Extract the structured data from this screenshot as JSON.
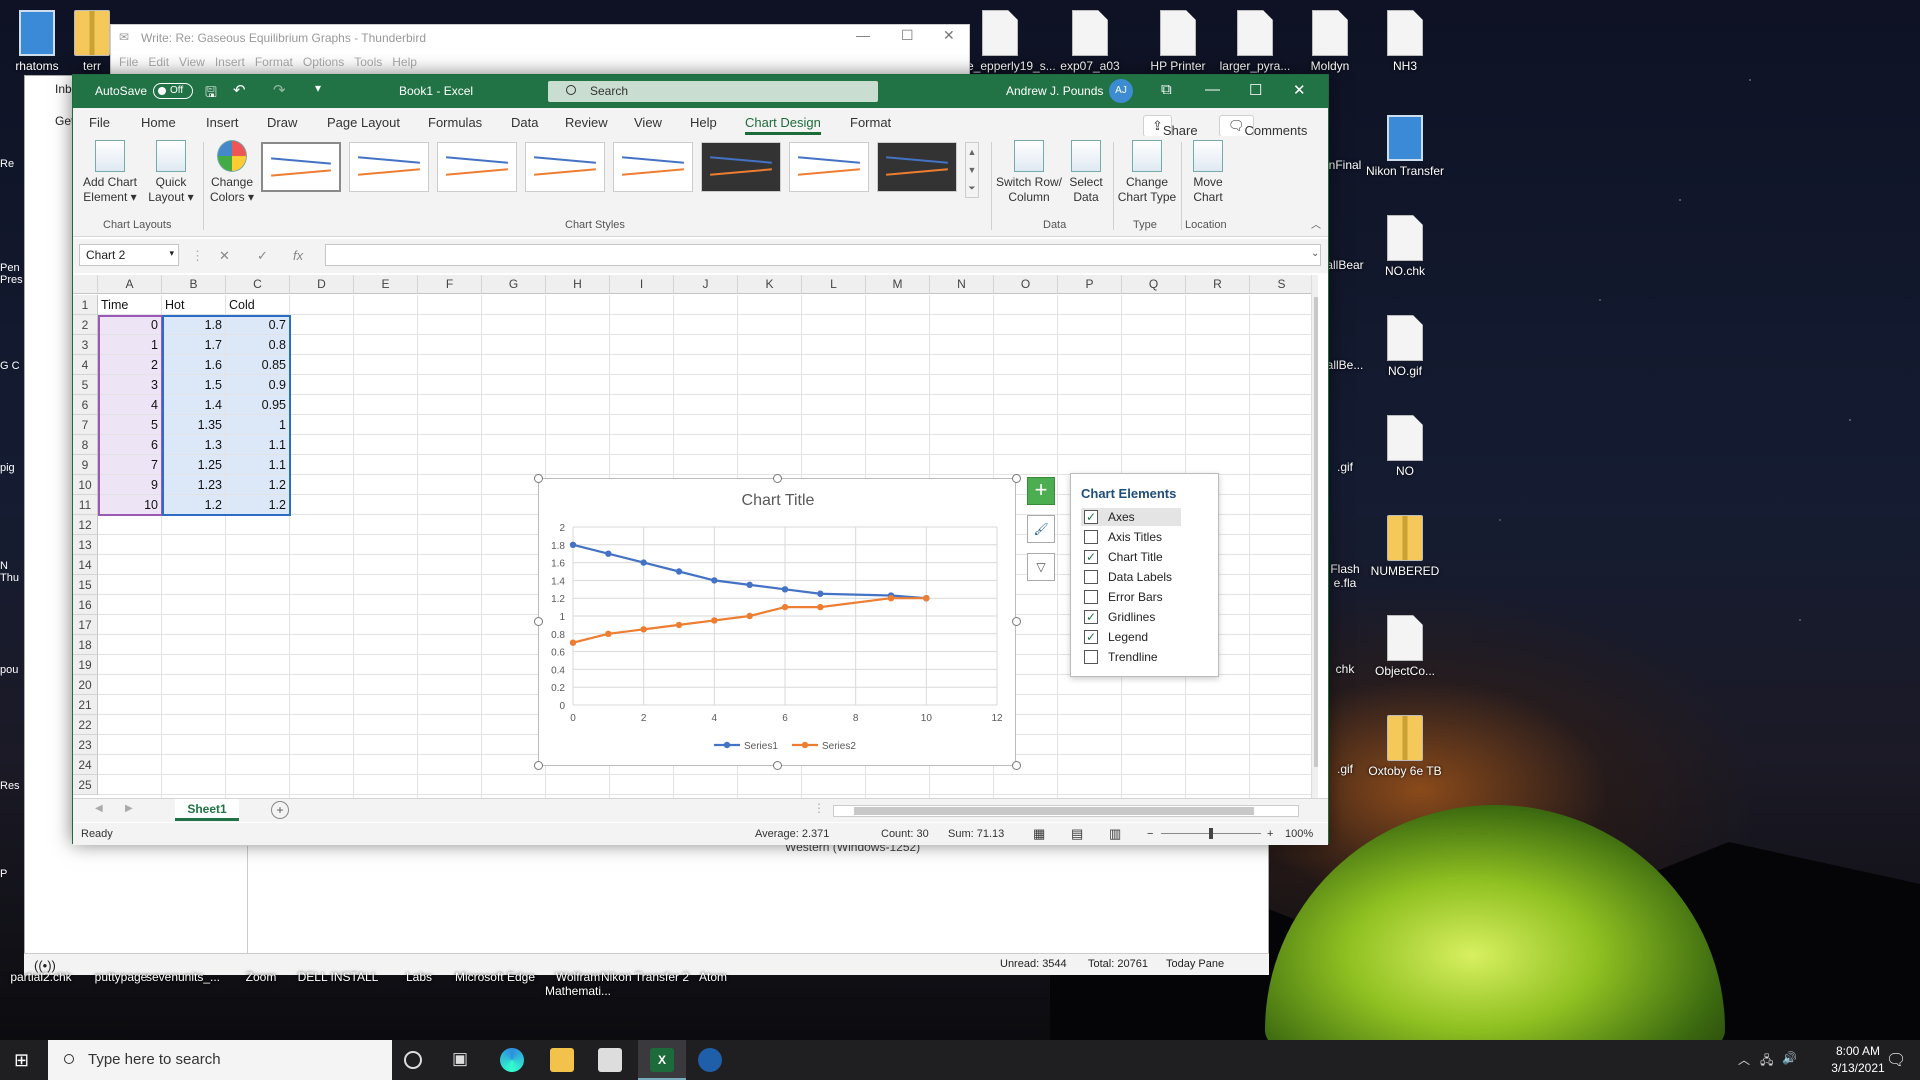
{
  "desktop": {
    "icons_top": [
      "rhatoms",
      "terr",
      "vite_epperly19_s...",
      "exp07_a03",
      "HP Printer",
      "larger_pyra...",
      "Moldyn",
      "NH3"
    ],
    "icons_right": [
      "Nikon Transfer",
      "NO.chk",
      "NO.gif",
      "NO",
      "NUMBERED",
      "ObjectCo...",
      "Oxtoby 6e TB"
    ],
    "icons_partial": [
      "nFinal",
      "allBear",
      "allBe...",
      ".gif",
      "Flash e.fla",
      "chk",
      ".gif"
    ],
    "left_strip": [
      "Re",
      "Pen Pres",
      "G C",
      "pig",
      "N Thu",
      "pou",
      "Res",
      "P"
    ],
    "bottom_icons": [
      "partial2.chk",
      "puttypage",
      "sevenunits_...",
      "Zoom",
      "DELL INSTALL",
      "Labs",
      "Microsoft Edge",
      "Wolfram Mathemati...",
      "Nikon Transfer 2",
      "Atom"
    ]
  },
  "thunderbird": {
    "compose_title": "Write: Re: Gaseous Equilibrium Graphs - Thunderbird",
    "menu": [
      "File",
      "Edit",
      "View",
      "Insert",
      "Format",
      "Options",
      "Tools",
      "Help"
    ],
    "sidebar_labels": [
      "Inb",
      "Get"
    ],
    "encoding": "Western (Windows-1252)",
    "status": {
      "unread": "Unread: 3544",
      "total": "Total: 20761",
      "today": "Today Pane"
    }
  },
  "excel": {
    "autosave": "AutoSave",
    "autosave_state": "Off",
    "book": "Book1 - Excel",
    "search": "Search",
    "user": "Andrew J. Pounds",
    "initials": "AJ",
    "tabs": [
      "File",
      "Home",
      "Insert",
      "Draw",
      "Page Layout",
      "Formulas",
      "Data",
      "Review",
      "View",
      "Help",
      "Chart Design",
      "Format"
    ],
    "share": "Share",
    "comments": "Comments",
    "ribbon": {
      "add_chart": "Add Chart Element",
      "quick_layout": "Quick Layout",
      "change_colors": "Change Colors",
      "switch": "Switch Row/ Column",
      "select_data": "Select Data",
      "change_type": "Change Chart Type",
      "move": "Move Chart",
      "groups": [
        "Chart Layouts",
        "Chart Styles",
        "Data",
        "Type",
        "Location"
      ]
    },
    "namebox": "Chart 2",
    "fx": "fx",
    "columns": [
      "A",
      "B",
      "C",
      "D",
      "E",
      "F",
      "G",
      "H",
      "I",
      "J",
      "K",
      "L",
      "M",
      "N",
      "O",
      "P",
      "Q",
      "R",
      "S"
    ],
    "rows": [
      "1",
      "2",
      "3",
      "4",
      "5",
      "6",
      "7",
      "8",
      "9",
      "10",
      "11",
      "12",
      "13",
      "14",
      "15",
      "16",
      "17",
      "18",
      "19",
      "20",
      "21",
      "22",
      "23",
      "24",
      "25"
    ],
    "headers": [
      "Time",
      "Hot",
      "Cold"
    ],
    "table": [
      [
        "0",
        "1.8",
        "0.7"
      ],
      [
        "1",
        "1.7",
        "0.8"
      ],
      [
        "2",
        "1.6",
        "0.85"
      ],
      [
        "3",
        "1.5",
        "0.9"
      ],
      [
        "4",
        "1.4",
        "0.95"
      ],
      [
        "5",
        "1.35",
        "1"
      ],
      [
        "6",
        "1.3",
        "1.1"
      ],
      [
        "7",
        "1.25",
        "1.1"
      ],
      [
        "9",
        "1.23",
        "1.2"
      ],
      [
        "10",
        "1.2",
        "1.2"
      ]
    ],
    "chart_elements": {
      "title": "Chart Elements",
      "items": [
        {
          "label": "Axes",
          "checked": true
        },
        {
          "label": "Axis Titles",
          "checked": false
        },
        {
          "label": "Chart Title",
          "checked": true
        },
        {
          "label": "Data Labels",
          "checked": false
        },
        {
          "label": "Error Bars",
          "checked": false
        },
        {
          "label": "Gridlines",
          "checked": true
        },
        {
          "label": "Legend",
          "checked": true
        },
        {
          "label": "Trendline",
          "checked": false
        }
      ]
    },
    "sheet": "Sheet1",
    "status": {
      "ready": "Ready",
      "average": "Average: 2.371",
      "count": "Count: 30",
      "sum": "Sum: 71.13",
      "zoom": "100%"
    }
  },
  "chart_data": {
    "type": "scatter",
    "title": "Chart Title",
    "xlim": [
      0,
      12
    ],
    "ylim": [
      0,
      2
    ],
    "xticks": [
      "0",
      "2",
      "4",
      "6",
      "8",
      "10",
      "12"
    ],
    "yticks": [
      "0",
      "0.2",
      "0.4",
      "0.6",
      "0.8",
      "1",
      "1.2",
      "1.4",
      "1.6",
      "1.8",
      "2"
    ],
    "grid": true,
    "legend": "bottom",
    "series": [
      {
        "name": "Series1",
        "color": "#4472c4",
        "x": [
          0,
          1,
          2,
          3,
          4,
          5,
          6,
          7,
          9,
          10
        ],
        "y": [
          1.8,
          1.7,
          1.6,
          1.5,
          1.4,
          1.35,
          1.3,
          1.25,
          1.23,
          1.2
        ]
      },
      {
        "name": "Series2",
        "color": "#ed7d31",
        "x": [
          0,
          1,
          2,
          3,
          4,
          5,
          6,
          7,
          9,
          10
        ],
        "y": [
          0.7,
          0.8,
          0.85,
          0.9,
          0.95,
          1,
          1.1,
          1.1,
          1.2,
          1.2
        ]
      }
    ]
  },
  "taskbar": {
    "search": "Type here to search",
    "time": "8:00 AM",
    "date": "3/13/2021"
  }
}
